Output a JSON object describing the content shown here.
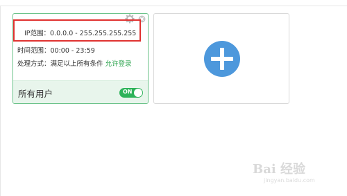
{
  "rule_card": {
    "ip_label": "IP范围：",
    "ip_value": "0.0.0.0 - 255.255.255.255",
    "time_label": "时间范围：",
    "time_value": "00:00 - 23:59",
    "action_label": "处理方式：",
    "action_condition": "满足以上所有条件 ",
    "action_value": "允许登录",
    "footer_label": "所有用户",
    "toggle_text": "ON",
    "toggle_on": true,
    "gear_icon": "gear-icon",
    "close_icon": "close-icon"
  },
  "add_card": {
    "icon": "plus-icon",
    "accent_color": "#4d98dc"
  },
  "watermark": {
    "text": "Bai 经验",
    "url": "jingyan.baidu.com"
  },
  "colors": {
    "card_border": "#6cc38a",
    "highlight": "#e0312f",
    "toggle": "#2eb35a",
    "link": "#2ea44f"
  }
}
